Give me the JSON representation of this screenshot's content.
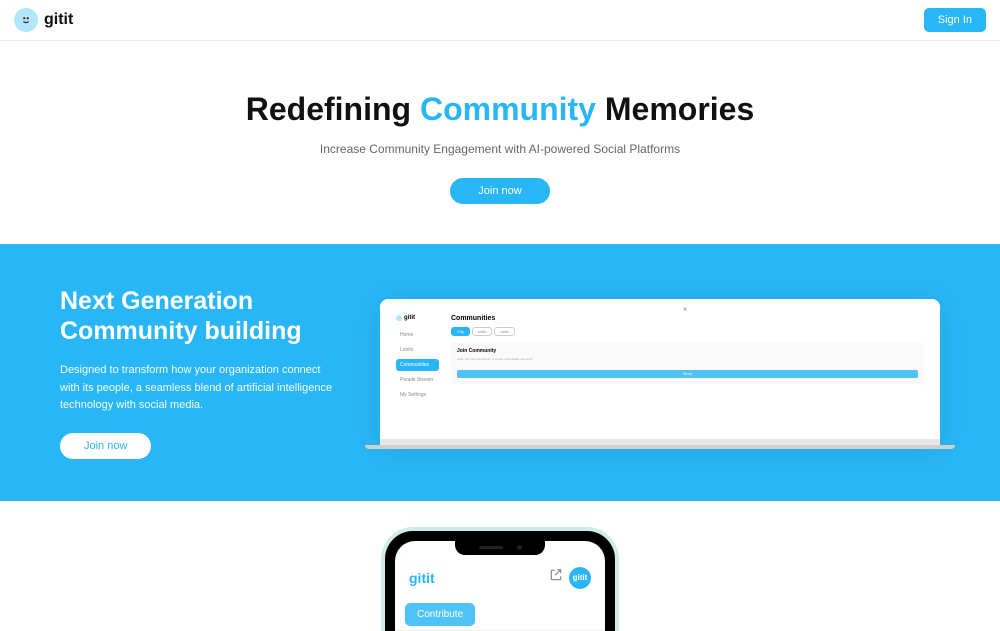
{
  "header": {
    "brand": "gitit",
    "signin_label": "Sign In"
  },
  "hero": {
    "title_pre": "Redefining ",
    "title_accent": "Community",
    "title_post": " Memories",
    "subtitle": "Increase Community Engagement with AI-powered Social Platforms",
    "cta_label": "Join now"
  },
  "feature": {
    "title": "Next Generation Community building",
    "description": "Designed to transform how your organization connect with its people, a seamless blend of artificial intelligence technology with social media.",
    "cta_label": "Join now"
  },
  "laptop_mock": {
    "brand": "gitit",
    "nav_items": [
      "Home",
      "Looks",
      "Communities",
      "People Stream",
      "My Settings"
    ],
    "nav_active_index": 2,
    "heading": "Communities",
    "chips": [
      "City",
      "usifo",
      "usifo"
    ],
    "card_title": "Join Community",
    "card_text": "usifo. Join the community to create memorable moments",
    "card_btn": "Send"
  },
  "phone_mock": {
    "brand": "gitit",
    "avatar_text": "gitit",
    "tab_label": "Contribute"
  }
}
